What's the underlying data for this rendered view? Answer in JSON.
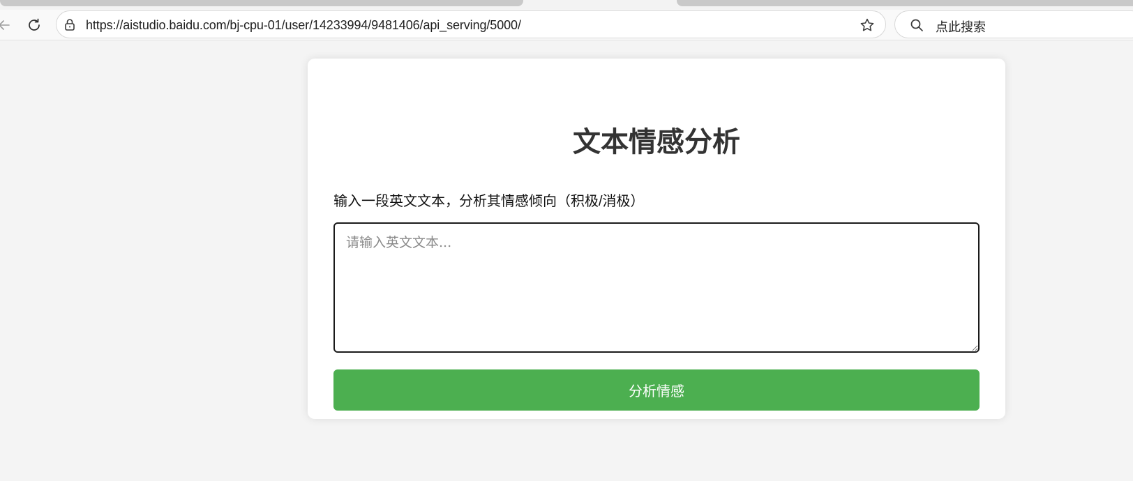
{
  "browser": {
    "url": "https://aistudio.baidu.com/bj-cpu-01/user/14233994/9481406/api_serving/5000/",
    "search_placeholder": "点此搜索",
    "icons": {
      "back": "arrow-left-icon",
      "reload": "reload-icon",
      "lock": "lock-icon",
      "favorite": "star-icon",
      "search": "search-icon"
    }
  },
  "app": {
    "title": "文本情感分析",
    "description": "输入一段英文文本，分析其情感倾向（积极/消极）",
    "input_placeholder": "请输入英文文本...",
    "input_value": "",
    "submit_label": "分析情感"
  },
  "colors": {
    "accent": "#4caf50",
    "page_background": "#f4f4f4",
    "card_background": "#ffffff",
    "title_text": "#333333"
  }
}
